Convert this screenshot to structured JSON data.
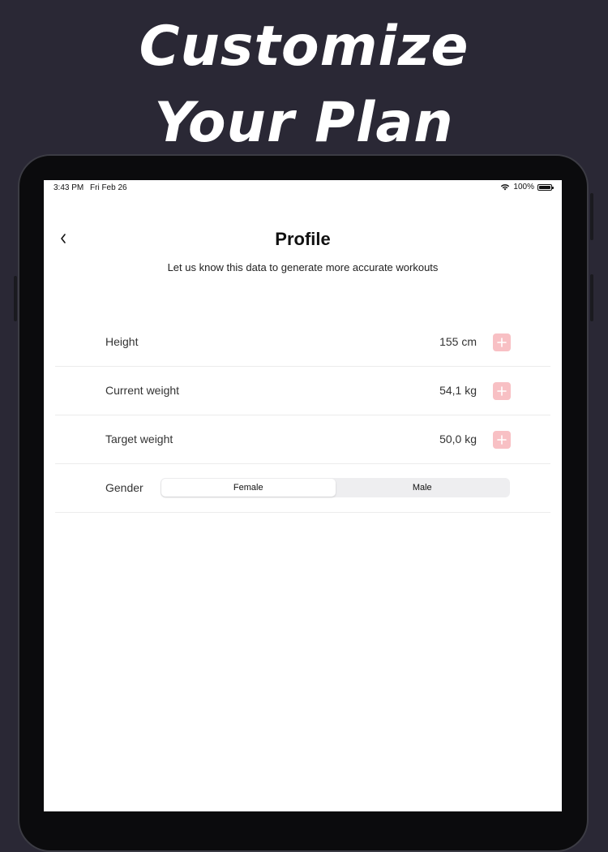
{
  "headline": {
    "line1": "Customize",
    "line2": "Your Plan"
  },
  "status_bar": {
    "time": "3:43 PM",
    "date": "Fri Feb 26",
    "battery": "100%"
  },
  "header": {
    "title": "Profile",
    "subtitle": "Let us know this data to generate more accurate workouts"
  },
  "profile_rows": [
    {
      "label": "Height",
      "value": "155 cm"
    },
    {
      "label": "Current weight",
      "value": "54,1 kg"
    },
    {
      "label": "Target weight",
      "value": "50,0 kg"
    }
  ],
  "gender": {
    "label": "Gender",
    "options": [
      "Female",
      "Male"
    ],
    "selected": "Female"
  },
  "colors": {
    "background": "#2a2835",
    "accent": "#f8c0c4",
    "screen": "#ffffff"
  }
}
